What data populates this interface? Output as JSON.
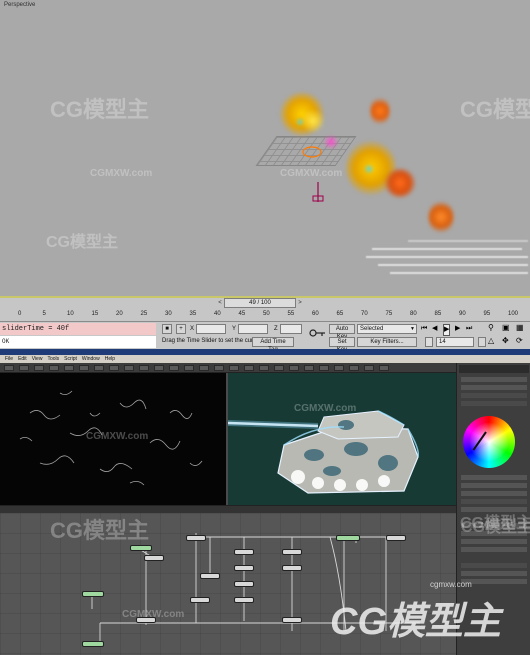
{
  "viewport": {
    "label": "Perspective"
  },
  "trackbar": {
    "slider_label": "49 / 100",
    "prev_arrow": "<",
    "next_arrow": ">",
    "ticks": [
      "0",
      "5",
      "10",
      "15",
      "20",
      "25",
      "30",
      "35",
      "40",
      "45",
      "50",
      "55",
      "60",
      "65",
      "70",
      "75",
      "80",
      "85",
      "90",
      "95",
      "100"
    ]
  },
  "statusbar": {
    "listener_line1": "sliderTime = 40f",
    "listener_line2": "OK",
    "x_label": "X",
    "y_label": "Y",
    "z_label": "Z",
    "x_value": "",
    "y_value": "",
    "z_value": "",
    "prompt": "Drag the Time Slider to set the curr",
    "add_time_tag": "Add Time Tag",
    "auto_key": "Auto Key",
    "set_key": "Set Key",
    "key_mode_selected": "Selected",
    "key_filters": "Key Filters...",
    "current_frame": "14",
    "lock_icon": "lock-icon",
    "key_icon": "key-icon"
  },
  "compositor": {
    "menu": [
      "File",
      "Edit",
      "View",
      "Tools",
      "Script",
      "Window",
      "Help"
    ]
  },
  "watermarks": {
    "small": "CGMXW.com",
    "logo": "CG模型主",
    "url": "cgmxw.com"
  },
  "colors": {
    "viewport_bg": "#a9a9a9",
    "timeline_highlight": "#c8c86a",
    "listener_pink": "#f2c8c8",
    "comp_title": "#1f3b78",
    "flow_bg": "#565656"
  }
}
